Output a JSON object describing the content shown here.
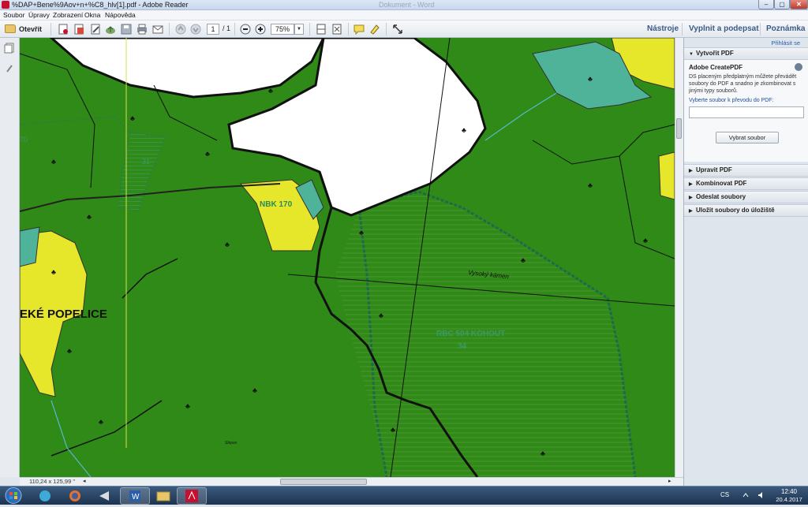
{
  "window": {
    "title": "%DAP+Bene%9Aov+n+%C8_hlv[1].pdf - Adobe Reader",
    "ghost_title": "Dokument - Word",
    "minimize": "–",
    "maximize": "▢",
    "close": "✕"
  },
  "menu": [
    "Soubor",
    "Úpravy",
    "Zobrazení",
    "Okna",
    "Nápověda"
  ],
  "toolbar": {
    "open_label": "Otevřít",
    "page_current": "1",
    "page_total": "/ 1",
    "zoom": "75%",
    "tools_label": "Nástroje",
    "fill_sign_label": "Vyplnit a podepsat",
    "comment_label": "Poznámka"
  },
  "map": {
    "labels": {
      "nbk": "NBK 170",
      "popelice": "EKÉ POPELICE",
      "vysoky_kamen": "Vysoký kámen",
      "rbc": "RBC 504 KOHOUT",
      "rbc_num": "34",
      "num31": "31",
      "num70": "70",
      "small_text": "Slepov"
    },
    "colors": {
      "forest": "#2f8a17",
      "forest_dark": "#247512",
      "meadow_yellow": "#e6e62a",
      "teal": "#4fb39a",
      "white_area": "#ffffff",
      "hatch": "#1f6a4a"
    }
  },
  "status": {
    "page_size": "110,24 x 125,99 \""
  },
  "panel": {
    "signin": "Přihlásit se",
    "sections": [
      {
        "label": "Vytvořit PDF",
        "expanded": true
      },
      {
        "label": "Upravit PDF",
        "expanded": false
      },
      {
        "label": "Kombinovat PDF",
        "expanded": false
      },
      {
        "label": "Odeslat soubory",
        "expanded": false
      },
      {
        "label": "Uložit soubory do úložiště",
        "expanded": false
      }
    ],
    "create_pdf": {
      "title": "Adobe CreatePDF",
      "description": "DS placeným předplatným můžete převádět soubory do PDF a snadno je zkombinovat s jinými typy souborů.",
      "select_label": "Vyberte soubor k převodu do PDF:",
      "file_value": "",
      "select_button": "Vybrat soubor"
    }
  },
  "taskbar": {
    "language": "CS",
    "time": "12:40",
    "date": "20.4.2017"
  }
}
